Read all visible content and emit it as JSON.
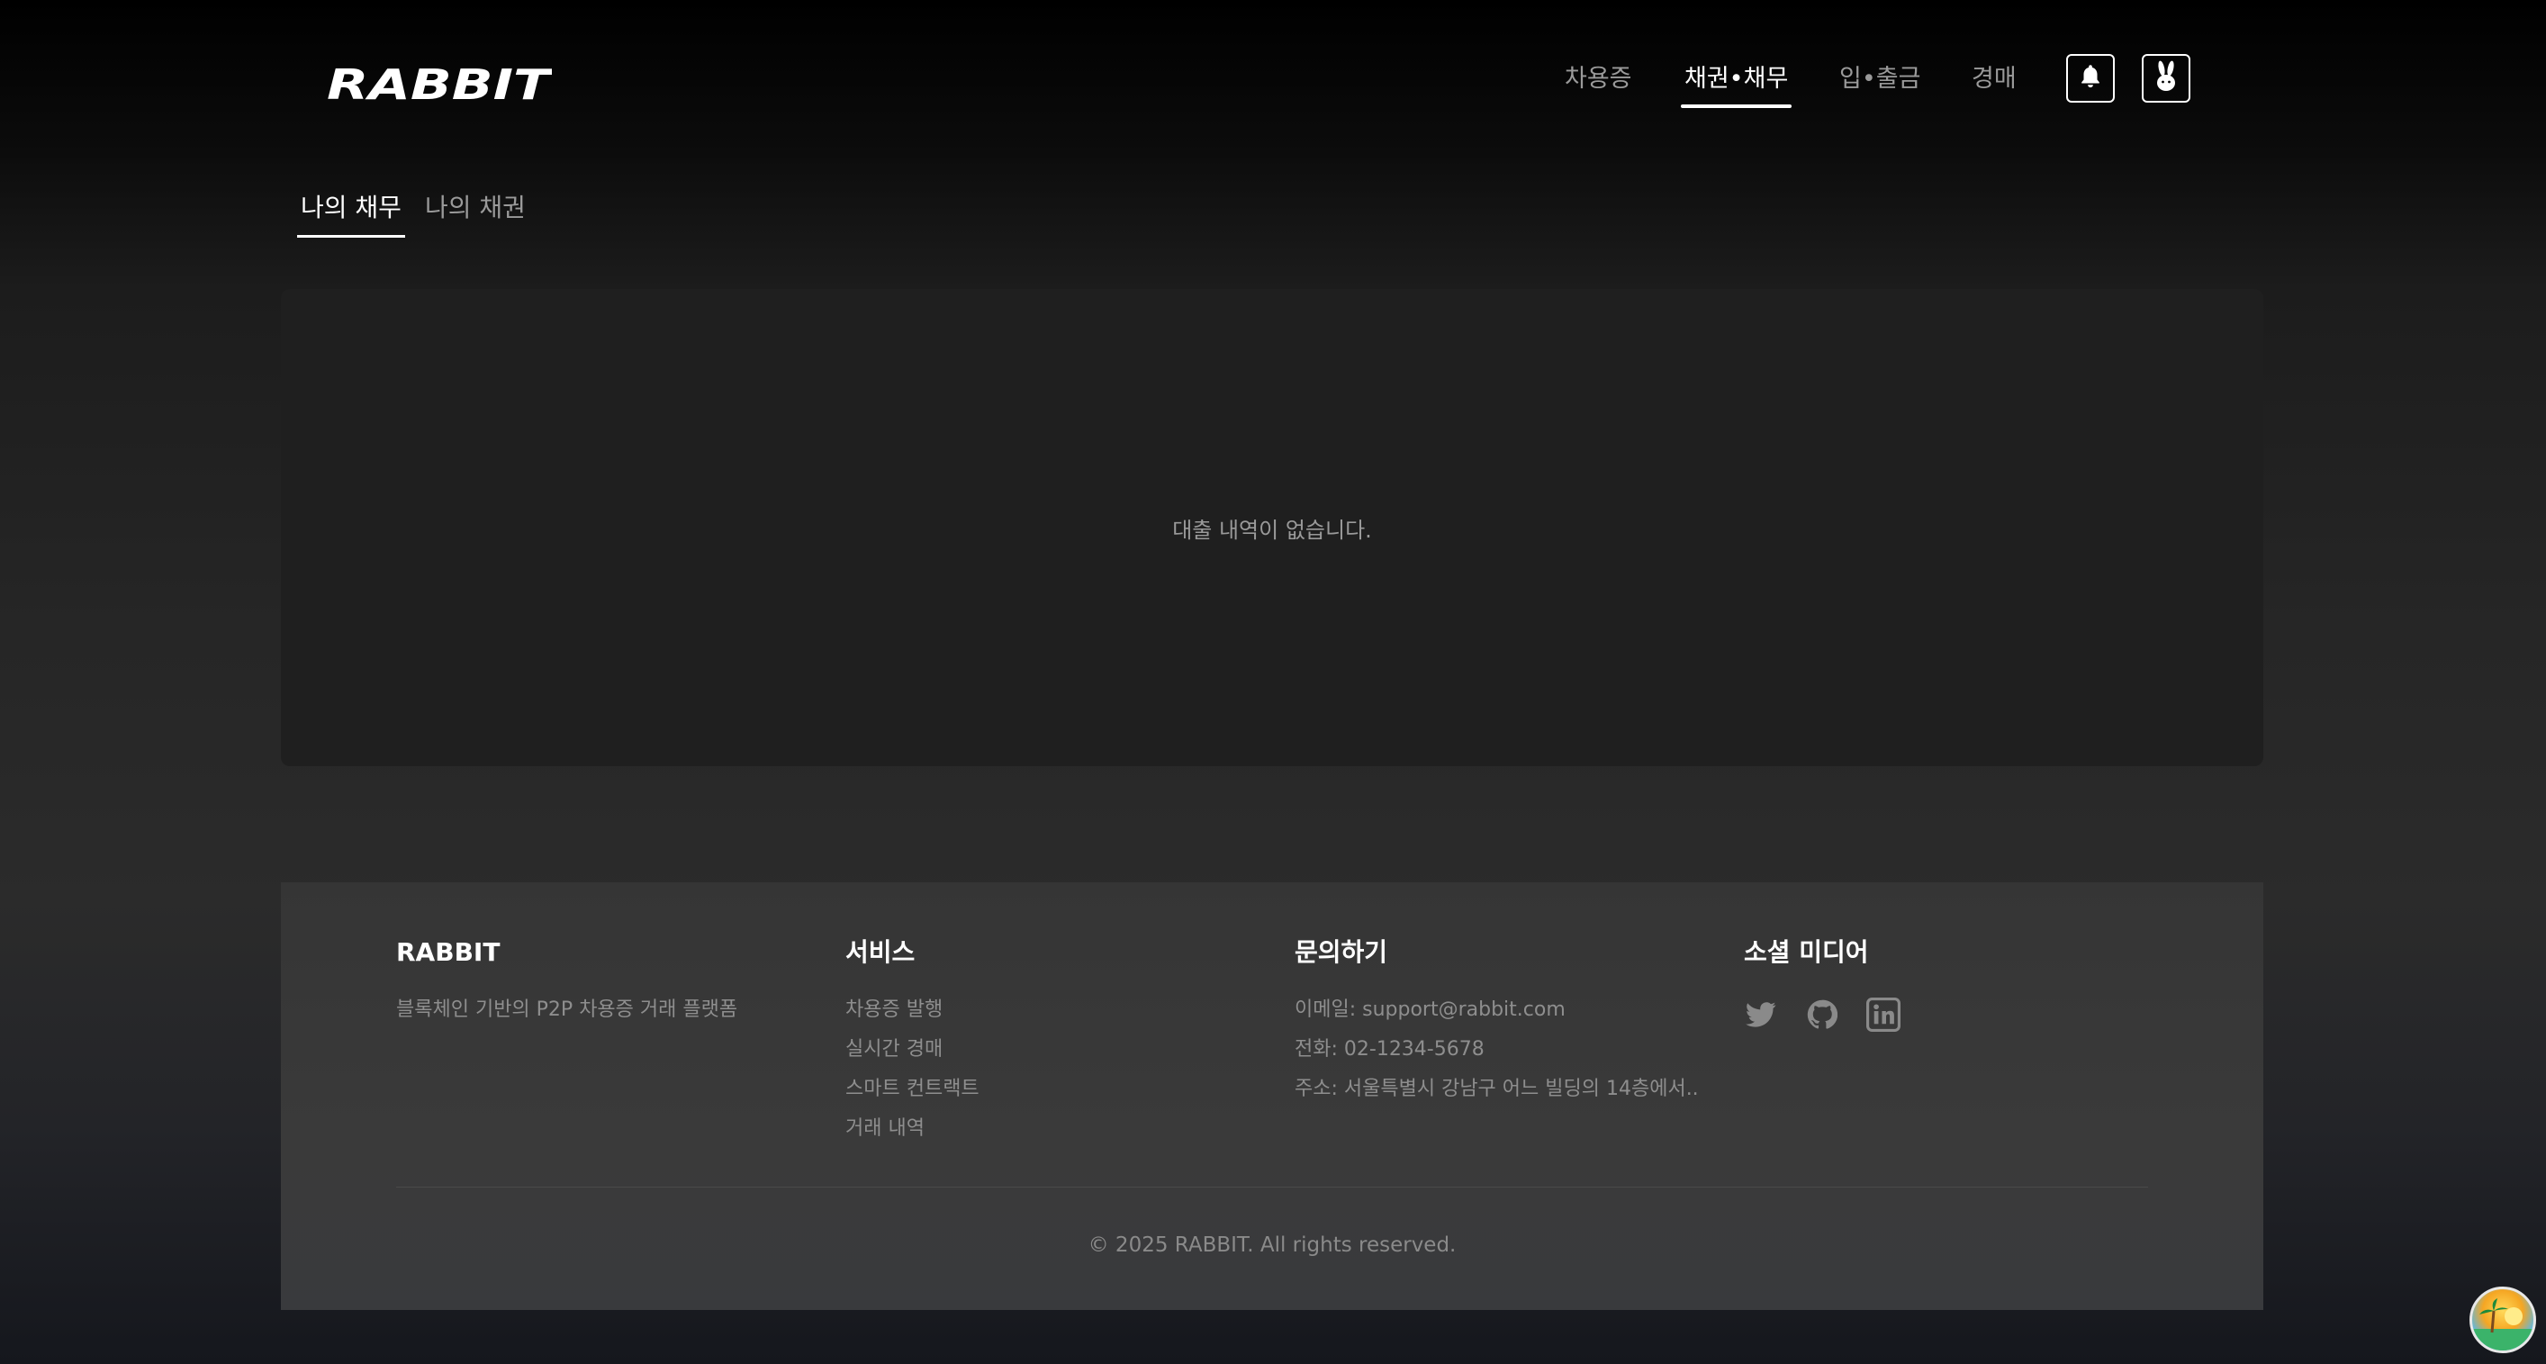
{
  "header": {
    "logo_text": "RABBIT",
    "nav": [
      {
        "label": "차용증",
        "active": false
      },
      {
        "label": "채권•채무",
        "active": true
      },
      {
        "label": "입•출금",
        "active": false
      },
      {
        "label": "경매",
        "active": false
      }
    ],
    "icons": [
      "bell-icon",
      "rabbit-icon"
    ]
  },
  "subtabs": [
    {
      "label": "나의 채무",
      "active": true
    },
    {
      "label": "나의 채권",
      "active": false
    }
  ],
  "main": {
    "empty_message": "대출 내역이 없습니다."
  },
  "footer": {
    "brand": {
      "title": "RABBIT",
      "description": "블록체인 기반의 P2P 차용증 거래 플랫폼"
    },
    "services": {
      "title": "서비스",
      "items": [
        "차용증 발행",
        "실시간 경매",
        "스마트 컨트랙트",
        "거래 내역"
      ]
    },
    "contact": {
      "title": "문의하기",
      "email": "이메일: support@rabbit.com",
      "phone": "전화: 02-1234-5678",
      "address": "주소: 서울특별시 강남구 어느 빌딩의 14층에서.."
    },
    "social": {
      "title": "소셜 미디어",
      "icons": [
        "twitter-icon",
        "github-icon",
        "linkedin-icon"
      ]
    },
    "copyright": "© 2025 RABBIT. All rights reserved."
  },
  "colors": {
    "active_text": "#ffffff",
    "inactive_text": "#9a9a9a",
    "panel_bg": "#1f1f1f",
    "footer_bg": "#363636"
  }
}
